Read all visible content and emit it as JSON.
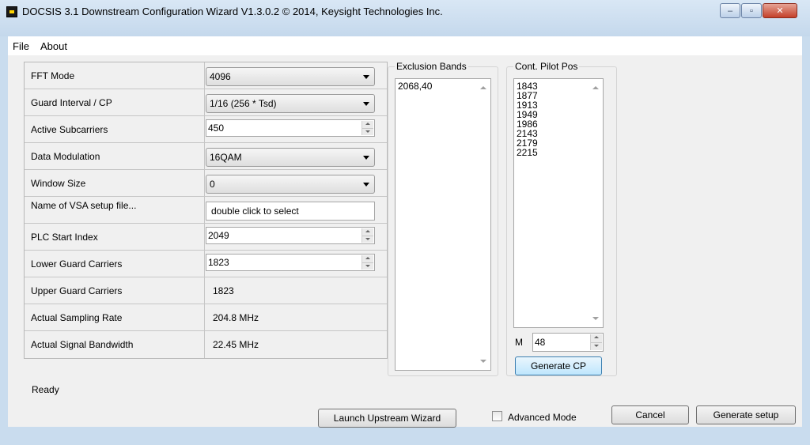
{
  "window": {
    "title": "DOCSIS 3.1 Downstream Configuration Wizard V1.3.0.2  © 2014, Keysight Technologies Inc.",
    "controls": [
      "–",
      "▫",
      "✕"
    ]
  },
  "menu": {
    "items": [
      "File",
      "About"
    ]
  },
  "form": {
    "fft_mode": {
      "label": "FFT Mode",
      "value": "4096"
    },
    "guard_interval": {
      "label": "Guard Interval / CP",
      "value": "1/16 (256 * Tsd)"
    },
    "active_subcarriers": {
      "label": "Active Subcarriers",
      "value": "450"
    },
    "data_modulation": {
      "label": "Data Modulation",
      "value": "16QAM"
    },
    "window_size": {
      "label": "Window Size",
      "value": "0"
    },
    "vsa_setup_file": {
      "label": "Name of VSA setup file...",
      "value": "double click to select"
    },
    "plc_start_index": {
      "label": "PLC Start Index",
      "value": "2049"
    },
    "lower_guard_carriers": {
      "label": "Lower Guard Carriers",
      "value": "1823"
    },
    "upper_guard_carriers": {
      "label": "Upper Guard Carriers",
      "value": "1823"
    },
    "actual_sampling_rate": {
      "label": "Actual Sampling Rate",
      "value": "204.8 MHz"
    },
    "actual_signal_bandwidth": {
      "label": "Actual Signal Bandwidth",
      "value": "22.45 MHz"
    }
  },
  "exclusion_bands": {
    "title": "Exclusion Bands",
    "items": [
      "2068,40"
    ]
  },
  "pilot_pos": {
    "title": "Cont. Pilot Pos",
    "items": [
      "1843",
      "1877",
      "1913",
      "1949",
      "1986",
      "2143",
      "2179",
      "2215"
    ],
    "m_label": "M",
    "m_value": "48",
    "generate_label": "Generate CP"
  },
  "status": {
    "text": "Ready"
  },
  "footer": {
    "launch_upstream": "Launch Upstream Wizard",
    "advanced_mode": "Advanced Mode",
    "advanced_checked": false,
    "cancel": "Cancel",
    "generate_setup": "Generate setup"
  }
}
